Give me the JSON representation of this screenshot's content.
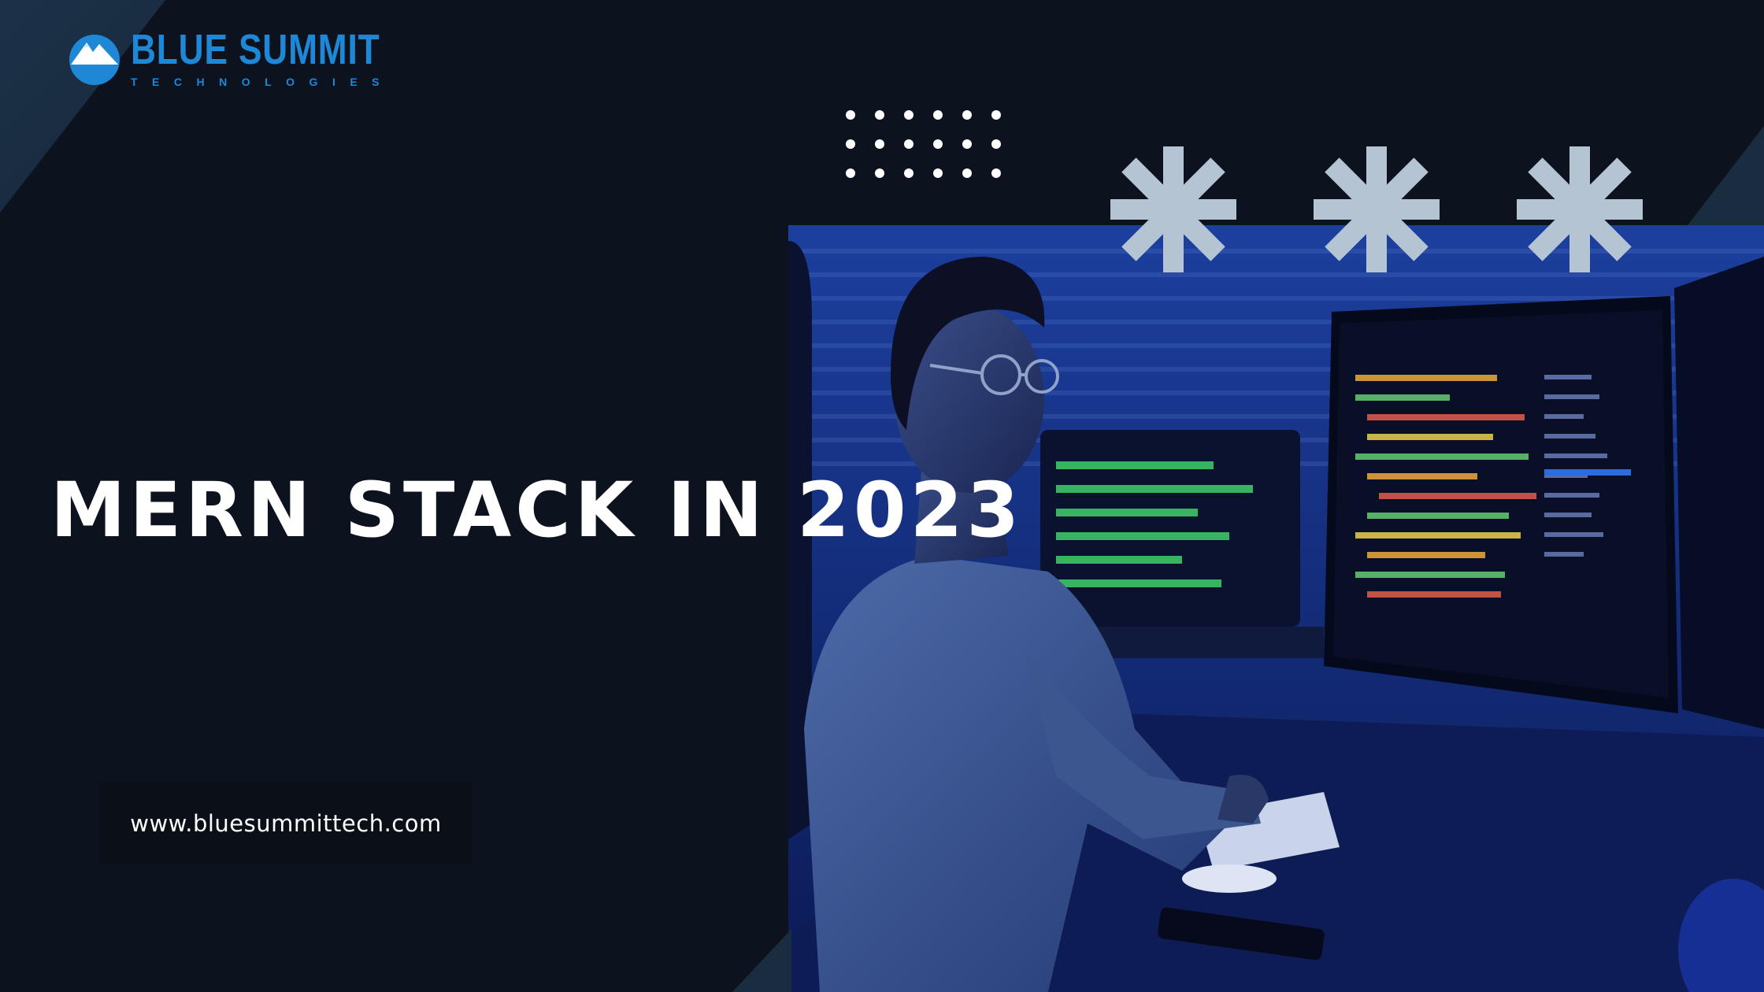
{
  "brand": {
    "name": "BLUE SUMMIT",
    "tagline": "TECHNOLOGIES",
    "logo_icon": "mountain-globe-icon",
    "accent_color": "#1e88d6"
  },
  "hero": {
    "title": "MERN STACK IN 2023",
    "photo": "developer-at-computer-photo"
  },
  "footer": {
    "url": "www.bluesummittech.com"
  },
  "decor": {
    "asterisk_color": "#b5c4d3",
    "asterisk_count": 3,
    "dot_grid_rows": 3,
    "dot_grid_cols": 6,
    "background_color": "#0d131e"
  }
}
